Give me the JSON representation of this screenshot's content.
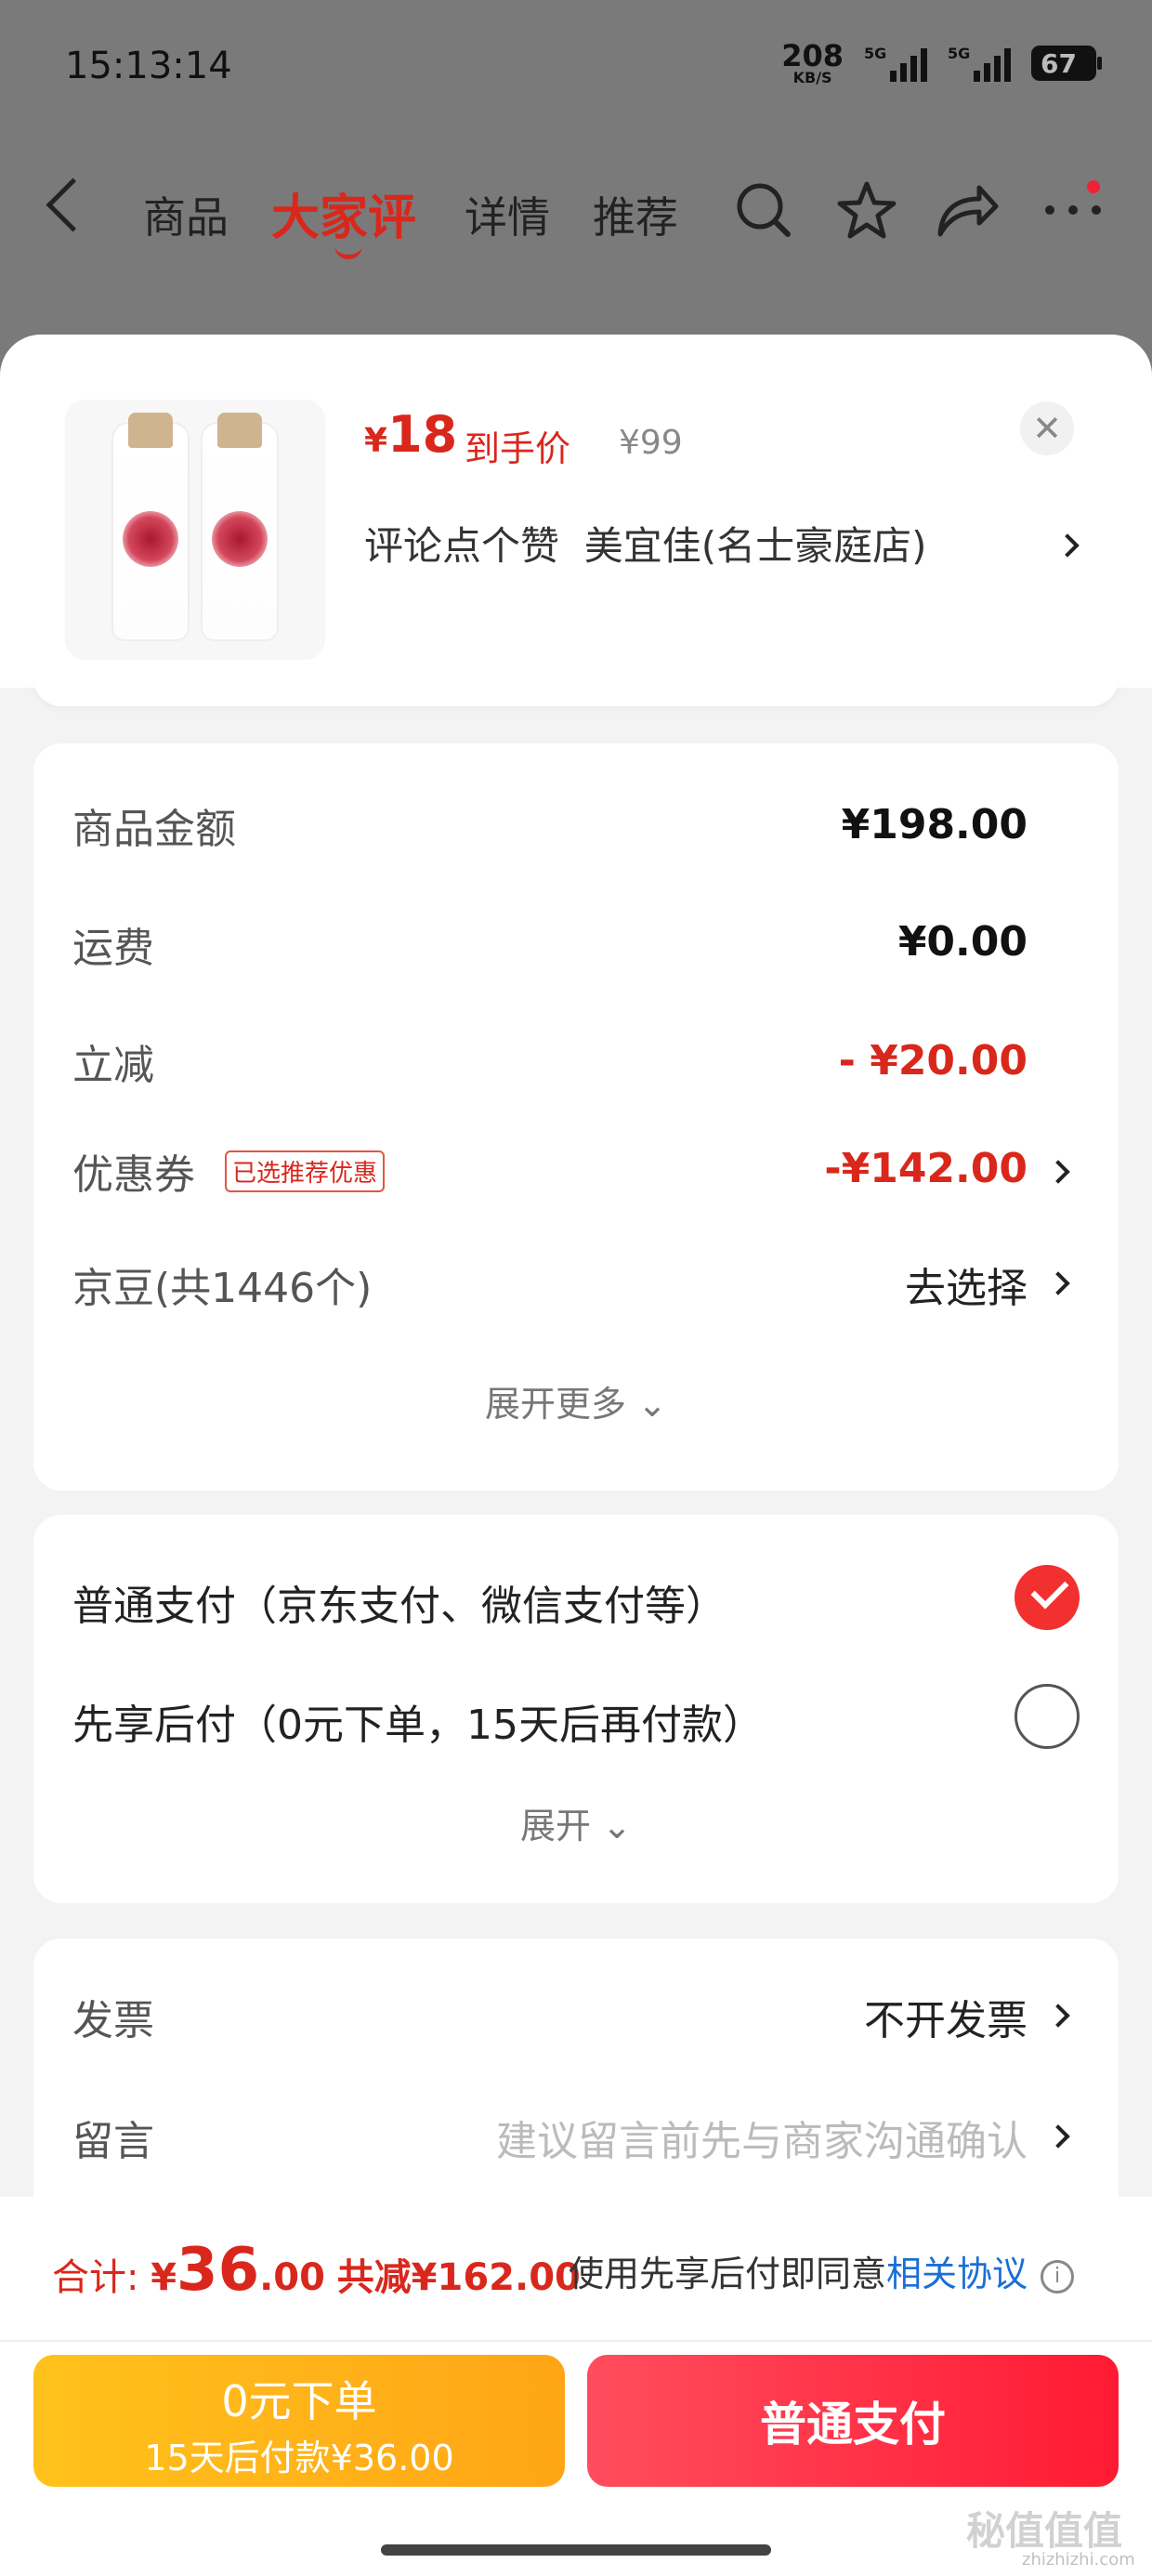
{
  "status_bar": {
    "time": "15:13:14",
    "net_speed": "208",
    "net_unit": "KB/S",
    "signal_1_label": "5G",
    "signal_2_label": "5G",
    "battery": "67"
  },
  "nav": {
    "tabs": [
      "商品",
      "大家评",
      "详情",
      "推荐"
    ],
    "active_tab": "大家评"
  },
  "product": {
    "price_symbol": "¥",
    "price": "18",
    "price_tag": "到手价",
    "original_price": "¥99",
    "review_promo": "评论点个赞",
    "store_name": "美宜佳(名士豪庭店)"
  },
  "summary": {
    "goods_label": "商品金额",
    "goods_value": "¥198.00",
    "shipping_label": "运费",
    "shipping_value": "¥0.00",
    "discount_label": "立减",
    "discount_value": "- ¥20.00",
    "coupon_label": "优惠券",
    "coupon_badge": "已选推荐优惠",
    "coupon_value": "-¥142.00",
    "beans_label": "京豆(共1446个)",
    "beans_action": "去选择",
    "expand_more": "展开更多"
  },
  "payment": {
    "normal_label": "普通支付（京东支付、微信支付等）",
    "later_label": "先享后付（0元下单，15天后再付款）",
    "expand": "展开",
    "selected": "normal"
  },
  "extras": {
    "invoice_label": "发票",
    "invoice_value": "不开发票",
    "message_label": "留言",
    "message_placeholder": "建议留言前先与商家沟通确认"
  },
  "footer": {
    "total_label": "合计:",
    "total_symbol": "¥",
    "total_int": "36",
    "total_dec": ".00",
    "total_saved": "共减¥162.00",
    "agree_text": "使用先享后付即同意",
    "agree_link": "相关协议",
    "btn_later_line1": "0元下单",
    "btn_later_line2": "15天后付款¥36.00",
    "btn_normal": "普通支付",
    "watermark": "秘值值值",
    "watermark_url": "zhizhizhi.com"
  },
  "colors": {
    "accent_red": "#d9271c",
    "button_red": "#ff1a33",
    "button_yellow": "#ffa516",
    "link_blue": "#1a6fd6"
  }
}
